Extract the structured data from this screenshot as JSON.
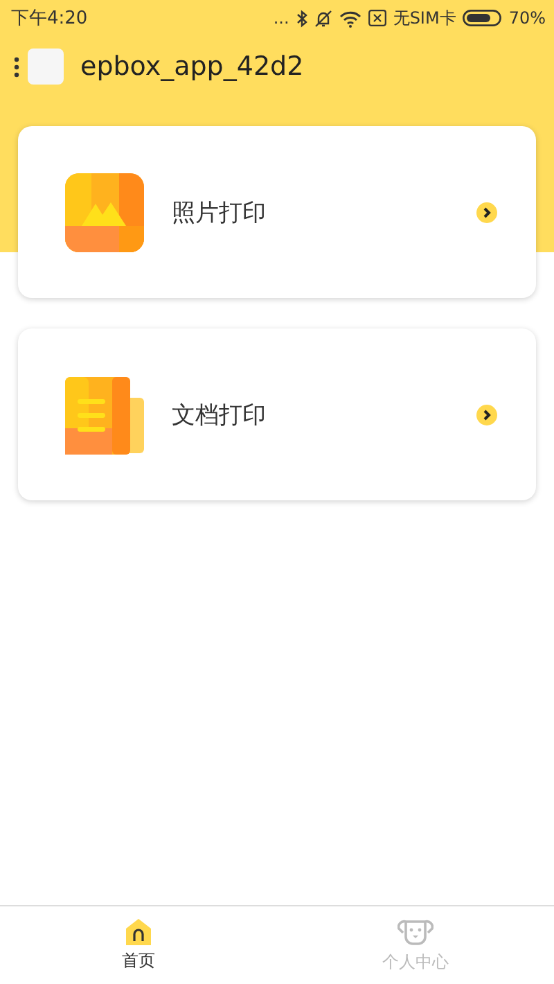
{
  "status_bar": {
    "time": "下午4:20",
    "more": "...",
    "carrier": "无SIM卡",
    "battery": "70%"
  },
  "header": {
    "title": "epbox_app_42d2"
  },
  "cards": [
    {
      "kind": "photo",
      "label": "照片打印"
    },
    {
      "kind": "document",
      "label": "文档打印"
    }
  ],
  "bottom_nav": [
    {
      "kind": "home",
      "label": "首页",
      "selected": true
    },
    {
      "kind": "profile",
      "label": "个人中心",
      "selected": false
    }
  ]
}
